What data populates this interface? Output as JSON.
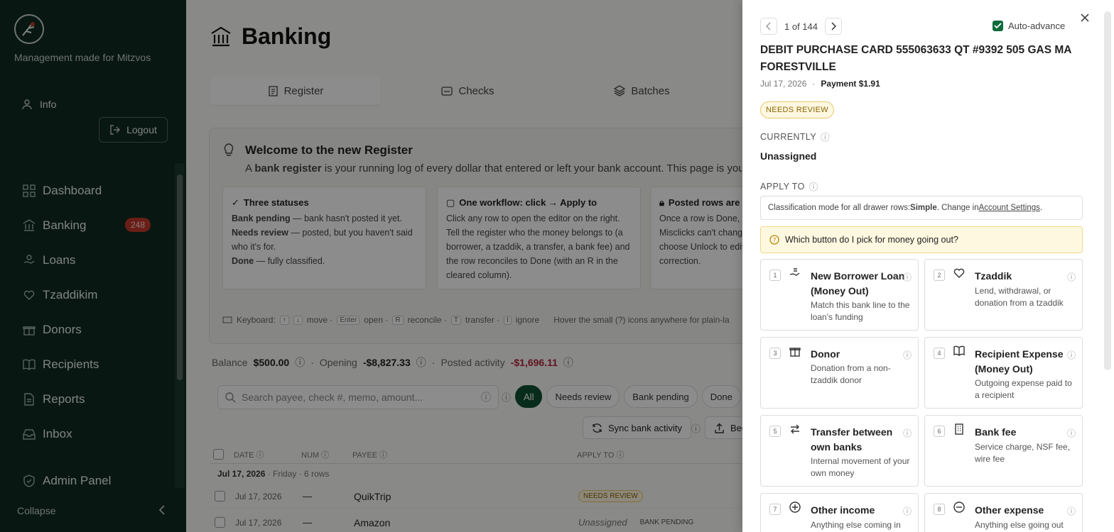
{
  "sidebar": {
    "tagline": "Management made for Mitzvos",
    "info": "Info",
    "logout": "Logout",
    "nav": [
      {
        "label": "Dashboard",
        "icon": "dashboard-icon"
      },
      {
        "label": "Banking",
        "icon": "bank-icon",
        "badge": "248"
      },
      {
        "label": "Loans",
        "icon": "loan-icon"
      },
      {
        "label": "Tzaddikim",
        "icon": "heart-hand-icon"
      },
      {
        "label": "Donors",
        "icon": "gift-icon"
      },
      {
        "label": "Recipients",
        "icon": "book-icon"
      },
      {
        "label": "Reports",
        "icon": "report-icon"
      },
      {
        "label": "Inbox",
        "icon": "inbox-icon"
      }
    ],
    "admin": "Admin Panel",
    "collapse": "Collapse"
  },
  "main": {
    "title": "Banking",
    "tabs": [
      "Register",
      "Checks",
      "Batches"
    ],
    "welcome": {
      "title": "Welcome to the new Register",
      "subtitle_pre": "A ",
      "subtitle_bold": "bank register",
      "subtitle_post": " is your running log of every dollar that entered or left your bank account. This page is your daily",
      "cards": [
        {
          "title": "Three statuses",
          "lines": [
            {
              "b": "Bank pending",
              "t": " — bank hasn't posted it yet."
            },
            {
              "b": "Needs review",
              "t": " — posted, but you haven't said who it's for."
            },
            {
              "b": "Done",
              "t": " — fully classified."
            }
          ]
        },
        {
          "title": "One workflow: click → Apply to",
          "text": "Click any row to open the editor on the right. Tell the register who the money belongs to (a borrower, a tzaddik, a transfer, a bank fee) and the row reconciles to Done (with an R in the cleared column)."
        },
        {
          "title": "Posted rows are lo",
          "text": "Once a row is Done, it Misclicks can't change choose Unlock to edit a correction."
        }
      ],
      "keyboard": {
        "label": "Keyboard:",
        "items": [
          {
            "k": "↑",
            "t": ""
          },
          {
            "k": "↓",
            "t": "move ·"
          },
          {
            "k": "Enter",
            "t": "open ·"
          },
          {
            "k": "R",
            "t": "reconcile ·"
          },
          {
            "k": "T",
            "t": "transfer ·"
          },
          {
            "k": "I",
            "t": "ignore"
          }
        ],
        "hint": "Hover the small (?) icons anywhere for plain-la"
      }
    },
    "balance": {
      "balance_label": "Balance",
      "balance": "$500.00",
      "opening_label": "Opening",
      "opening": "-$8,827.33",
      "posted_label": "Posted activity",
      "posted": "-$1,696.11"
    },
    "search_placeholder": "Search payee, check #, memo, amount...",
    "filters": [
      "All",
      "Needs review",
      "Bank pending",
      "Done",
      "T"
    ],
    "sync": "Sync bank activity",
    "begin": "Beg",
    "columns": [
      "DATE",
      "NUM",
      "PAYEE",
      "APPLY TO"
    ],
    "group": {
      "date": "Jul 17, 2026",
      "rest": " · Friday · 6 rows"
    },
    "rows": [
      {
        "date": "Jul 17, 2026",
        "num": "—",
        "payee": "QuikTrip",
        "apply": "",
        "status": "NEEDS REVIEW"
      },
      {
        "date": "Jul 17, 2026",
        "num": "—",
        "payee": "Amazon",
        "apply": "Unassigned",
        "status": "BANK PENDING"
      }
    ]
  },
  "drawer": {
    "pager": "1 of 144",
    "auto_advance": "Auto-advance",
    "title": "DEBIT PURCHASE CARD 555063633 QT #9392 505 GAS MA FORESTVILLE",
    "date": "Jul 17, 2026",
    "payment": "Payment $1.91",
    "status": "NEEDS REVIEW",
    "currently_label": "CURRENTLY",
    "currently_value": "Unassigned",
    "apply_label": "APPLY TO",
    "mode_pre": "Classification mode for all drawer rows: ",
    "mode_bold": "Simple",
    "mode_mid": ". Change in ",
    "mode_link": "Account Settings",
    "mode_end": ".",
    "hint": "Which button do I pick for money going out?",
    "options": [
      {
        "num": "1",
        "title": "New Borrower Loan (Money Out)",
        "desc": "Match this bank line to the loan's funding",
        "icon": "loan-hand-icon"
      },
      {
        "num": "2",
        "title": "Tzaddik",
        "desc": "Lend, withdrawal, or donation from a tzaddik",
        "icon": "heart-hand-icon"
      },
      {
        "num": "3",
        "title": "Donor",
        "desc": "Donation from a non-tzaddik donor",
        "icon": "gift-icon"
      },
      {
        "num": "4",
        "title": "Recipient Expense (Money Out)",
        "desc": "Outgoing expense paid to a recipient",
        "icon": "book-icon"
      },
      {
        "num": "5",
        "title": "Transfer between own banks",
        "desc": "Internal movement of your own money",
        "icon": "transfer-icon"
      },
      {
        "num": "6",
        "title": "Bank fee",
        "desc": "Service charge, NSF fee, wire fee",
        "icon": "building-icon"
      },
      {
        "num": "7",
        "title": "Other income",
        "desc": "Anything else coming in",
        "icon": "plus-circle-icon"
      },
      {
        "num": "8",
        "title": "Other expense",
        "desc": "Anything else going out",
        "icon": "minus-circle-icon"
      }
    ]
  },
  "colors": {
    "sidebar": "#0f2b22",
    "accent": "#0f5132",
    "badge": "#c0392b",
    "negative": "#b0283c",
    "warning_bg": "#fff8e1"
  }
}
